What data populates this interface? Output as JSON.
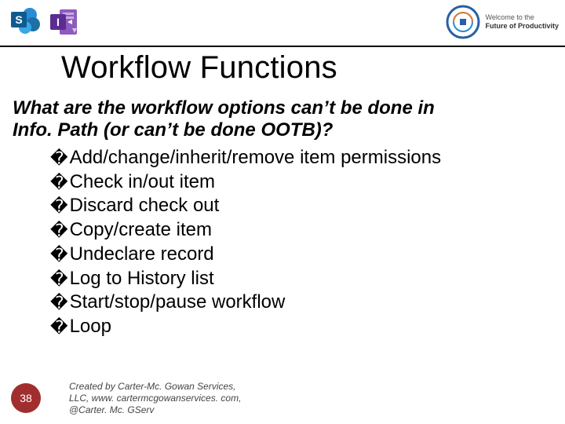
{
  "header": {
    "icons": {
      "sharepoint": "sharepoint-icon",
      "infopath": "infopath-icon",
      "seal": "productivity-seal-icon"
    },
    "badge": {
      "line1": "Welcome to the",
      "line2": "Future of Productivity"
    }
  },
  "title": "Workflow Functions",
  "question_line1": "What are the workflow options can’t be done in",
  "question_line2": "Info. Path (or can’t be done OOTB)?",
  "bullets": [
    "Add/change/inherit/remove item permissions",
    "Check in/out item",
    "Discard check out",
    "Copy/create item",
    "Undeclare record",
    "Log to History list",
    "Start/stop/pause workflow",
    "Loop"
  ],
  "page_number": "38",
  "credits_line1": "Created by Carter-Mc. Gowan Services,",
  "credits_line2": "LLC, www. cartermcgowanservices. com,",
  "credits_line3": "@Carter. Mc. GServ",
  "marker": "�"
}
